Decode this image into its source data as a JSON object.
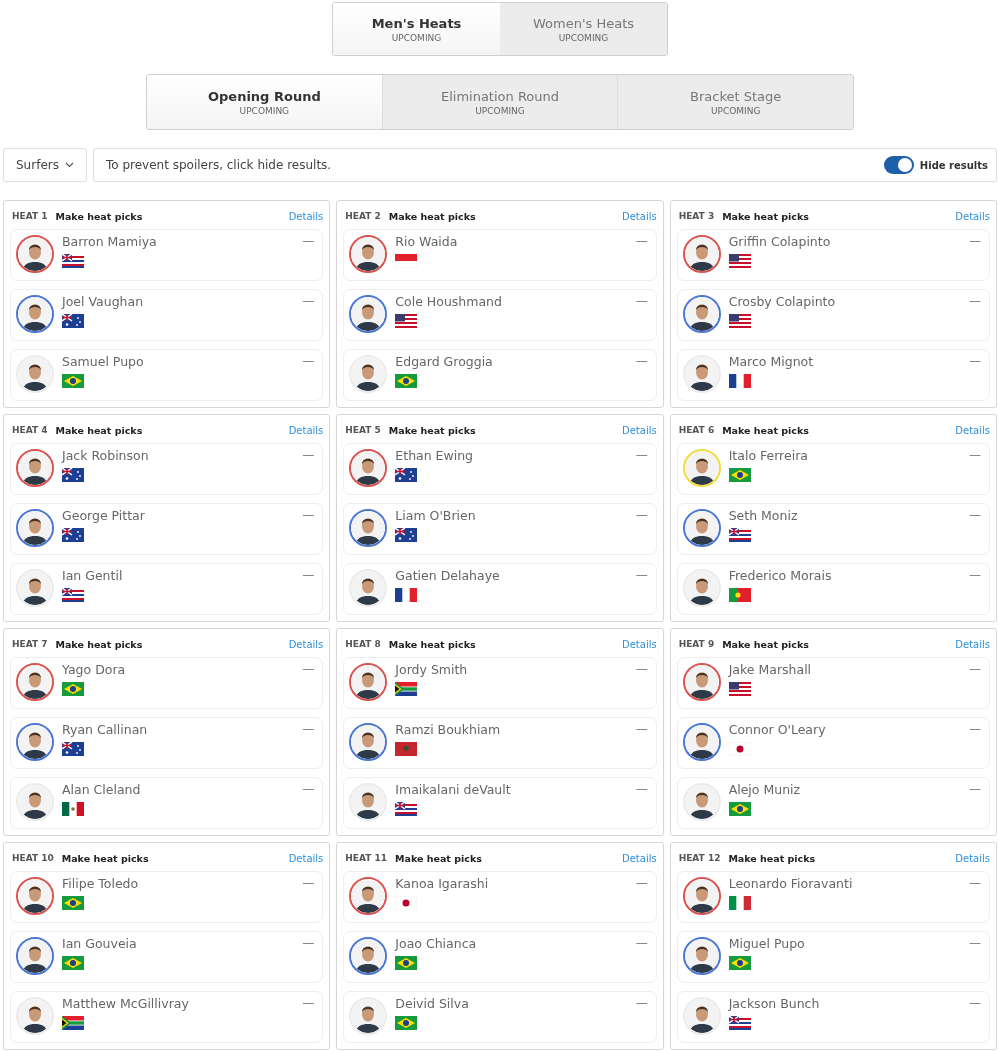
{
  "gender_tabs": [
    {
      "label": "Men's Heats",
      "status": "UPCOMING",
      "selected": true
    },
    {
      "label": "Women's Heats",
      "status": "UPCOMING",
      "selected": false
    }
  ],
  "round_tabs": [
    {
      "label": "Opening Round",
      "status": "UPCOMING",
      "selected": true
    },
    {
      "label": "Elimination Round",
      "status": "UPCOMING",
      "selected": false
    },
    {
      "label": "Bracket Stage",
      "status": "UPCOMING",
      "selected": false
    }
  ],
  "toolbar": {
    "filter": "Surfers",
    "message": "To prevent spoilers, click hide results.",
    "toggle": {
      "label": "Hide results",
      "on": true
    }
  },
  "heats": [
    {
      "title": "HEAT 1",
      "action": "Make heat picks",
      "link": "Details",
      "surfers": [
        {
          "name": "Barron Mamiya",
          "flag": {
            "kind": "hi"
          },
          "color": "#d9534f",
          "result": "—"
        },
        {
          "name": "Joel Vaughan",
          "flag": {
            "kind": "au"
          },
          "color": "#4a77d4",
          "result": "—"
        },
        {
          "name": "Samuel Pupo",
          "flag": {
            "kind": "br"
          },
          "color": "#ebebeb",
          "result": "—"
        }
      ]
    },
    {
      "title": "HEAT 2",
      "action": "Make heat picks",
      "link": "Details",
      "surfers": [
        {
          "name": "Rio Waida",
          "flag": {
            "kind": "id"
          },
          "color": "#d9534f",
          "result": "—"
        },
        {
          "name": "Cole Houshmand",
          "flag": {
            "kind": "us"
          },
          "color": "#4a77d4",
          "result": "—"
        },
        {
          "name": "Edgard Groggia",
          "flag": {
            "kind": "br"
          },
          "color": "#ebebeb",
          "result": "—"
        }
      ]
    },
    {
      "title": "HEAT 3",
      "action": "Make heat picks",
      "link": "Details",
      "surfers": [
        {
          "name": "Griffin Colapinto",
          "flag": {
            "kind": "us"
          },
          "color": "#d9534f",
          "result": "—"
        },
        {
          "name": "Crosby Colapinto",
          "flag": {
            "kind": "us"
          },
          "color": "#4a77d4",
          "result": "—"
        },
        {
          "name": "Marco Mignot",
          "flag": {
            "kind": "fr"
          },
          "color": "#ebebeb",
          "result": "—"
        }
      ]
    },
    {
      "title": "HEAT 4",
      "action": "Make heat picks",
      "link": "Details",
      "surfers": [
        {
          "name": "Jack Robinson",
          "flag": {
            "kind": "au"
          },
          "color": "#d9534f",
          "result": "—"
        },
        {
          "name": "George Pittar",
          "flag": {
            "kind": "au"
          },
          "color": "#4a77d4",
          "result": "—"
        },
        {
          "name": "Ian Gentil",
          "flag": {
            "kind": "hi"
          },
          "color": "#ebebeb",
          "result": "—"
        }
      ]
    },
    {
      "title": "HEAT 5",
      "action": "Make heat picks",
      "link": "Details",
      "surfers": [
        {
          "name": "Ethan Ewing",
          "flag": {
            "kind": "au"
          },
          "color": "#d9534f",
          "result": "—"
        },
        {
          "name": "Liam O'Brien",
          "flag": {
            "kind": "au"
          },
          "color": "#4a77d4",
          "result": "—"
        },
        {
          "name": "Gatien Delahaye",
          "flag": {
            "kind": "fr"
          },
          "color": "#ebebeb",
          "result": "—"
        }
      ]
    },
    {
      "title": "HEAT 6",
      "action": "Make heat picks",
      "link": "Details",
      "surfers": [
        {
          "name": "Italo Ferreira",
          "flag": {
            "kind": "br"
          },
          "color": "#f0dc3c",
          "result": "—"
        },
        {
          "name": "Seth Moniz",
          "flag": {
            "kind": "hi"
          },
          "color": "#4a77d4",
          "result": "—"
        },
        {
          "name": "Frederico Morais",
          "flag": {
            "kind": "pt"
          },
          "color": "#ebebeb",
          "result": "—"
        }
      ]
    },
    {
      "title": "HEAT 7",
      "action": "Make heat picks",
      "link": "Details",
      "surfers": [
        {
          "name": "Yago Dora",
          "flag": {
            "kind": "br"
          },
          "color": "#d9534f",
          "result": "—"
        },
        {
          "name": "Ryan Callinan",
          "flag": {
            "kind": "au"
          },
          "color": "#4a77d4",
          "result": "—"
        },
        {
          "name": "Alan Cleland",
          "flag": {
            "kind": "mx"
          },
          "color": "#ebebeb",
          "result": "—"
        }
      ]
    },
    {
      "title": "HEAT 8",
      "action": "Make heat picks",
      "link": "Details",
      "surfers": [
        {
          "name": "Jordy Smith",
          "flag": {
            "kind": "za"
          },
          "color": "#d9534f",
          "result": "—"
        },
        {
          "name": "Ramzi Boukhiam",
          "flag": {
            "kind": "ma"
          },
          "color": "#4a77d4",
          "result": "—"
        },
        {
          "name": "Imaikalani deVault",
          "flag": {
            "kind": "hi"
          },
          "color": "#ebebeb",
          "result": "—"
        }
      ]
    },
    {
      "title": "HEAT 9",
      "action": "Make heat picks",
      "link": "Details",
      "surfers": [
        {
          "name": "Jake Marshall",
          "flag": {
            "kind": "us"
          },
          "color": "#d9534f",
          "result": "—"
        },
        {
          "name": "Connor O'Leary",
          "flag": {
            "kind": "jp"
          },
          "color": "#4a77d4",
          "result": "—"
        },
        {
          "name": "Alejo Muniz",
          "flag": {
            "kind": "br"
          },
          "color": "#ebebeb",
          "result": "—"
        }
      ]
    },
    {
      "title": "HEAT 10",
      "action": "Make heat picks",
      "link": "Details",
      "surfers": [
        {
          "name": "Filipe Toledo",
          "flag": {
            "kind": "br"
          },
          "color": "#d9534f",
          "result": "—"
        },
        {
          "name": "Ian Gouveia",
          "flag": {
            "kind": "br"
          },
          "color": "#4a77d4",
          "result": "—"
        },
        {
          "name": "Matthew McGillivray",
          "flag": {
            "kind": "za"
          },
          "color": "#ebebeb",
          "result": "—"
        }
      ]
    },
    {
      "title": "HEAT 11",
      "action": "Make heat picks",
      "link": "Details",
      "surfers": [
        {
          "name": "Kanoa Igarashi",
          "flag": {
            "kind": "jp"
          },
          "color": "#d9534f",
          "result": "—"
        },
        {
          "name": "Joao Chianca",
          "flag": {
            "kind": "br"
          },
          "color": "#4a77d4",
          "result": "—"
        },
        {
          "name": "Deivid Silva",
          "flag": {
            "kind": "br"
          },
          "color": "#ebebeb",
          "result": "—"
        }
      ]
    },
    {
      "title": "HEAT 12",
      "action": "Make heat picks",
      "link": "Details",
      "surfers": [
        {
          "name": "Leonardo Fioravanti",
          "flag": {
            "kind": "it"
          },
          "color": "#d9534f",
          "result": "—"
        },
        {
          "name": "Miguel Pupo",
          "flag": {
            "kind": "br"
          },
          "color": "#4a77d4",
          "result": "—"
        },
        {
          "name": "Jackson Bunch",
          "flag": {
            "kind": "hi"
          },
          "color": "#ebebeb",
          "result": "—"
        }
      ]
    }
  ]
}
